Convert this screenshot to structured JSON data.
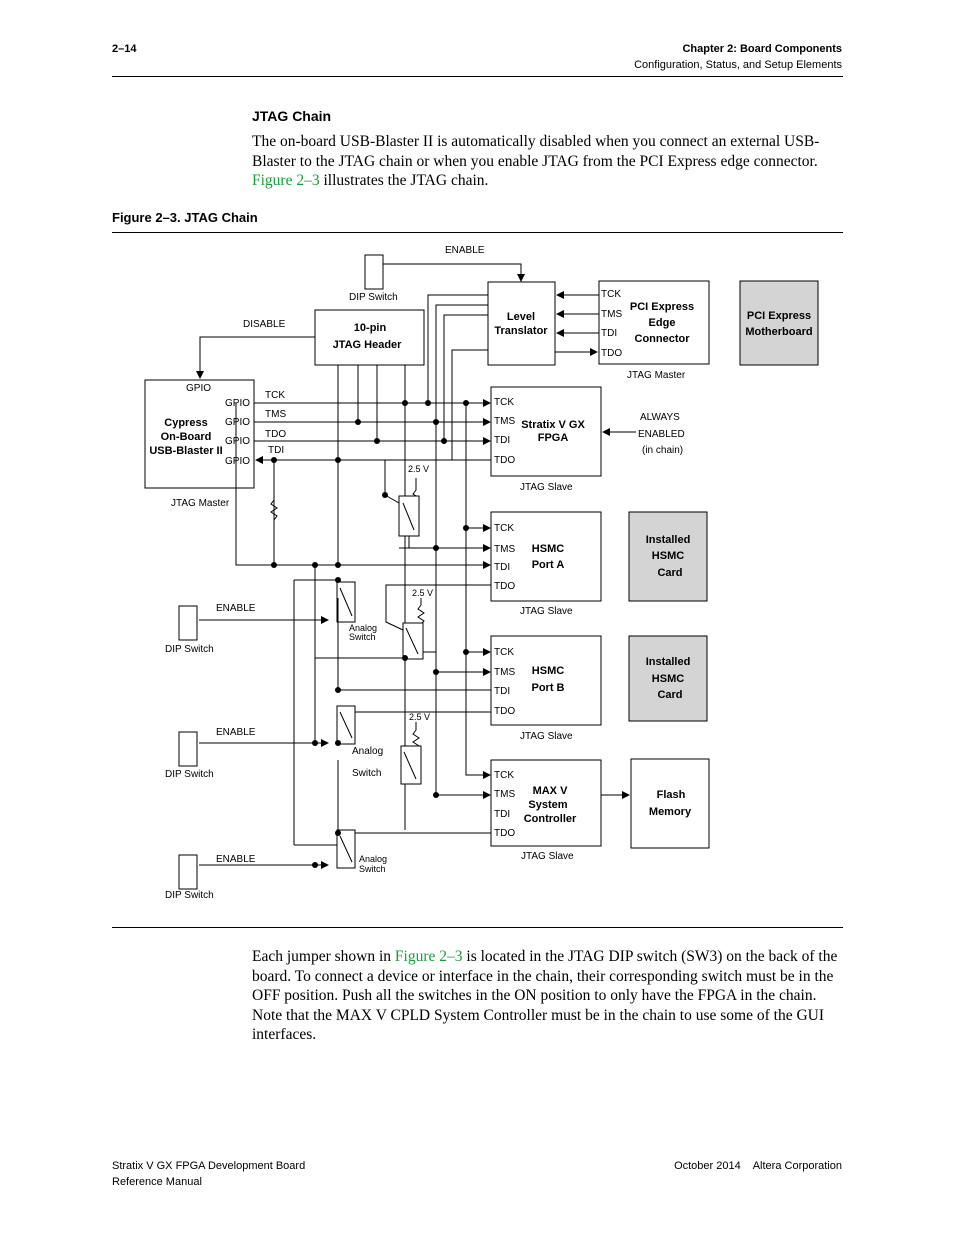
{
  "header": {
    "page_number": "2–14",
    "chapter": "Chapter 2:  Board Components",
    "section": "Configuration, Status, and Setup Elements"
  },
  "section": {
    "title": "JTAG Chain",
    "intro": {
      "part1": "The on-board USB-Blaster II is automatically disabled when you connect an external USB-Blaster to the JTAG chain or when you enable JTAG from the PCI Express edge connector. ",
      "link": "Figure 2–3",
      "part2": " illustrates the JTAG chain."
    }
  },
  "figure": {
    "caption": "Figure 2–3.  JTAG Chain",
    "colors": {
      "line": "#000000",
      "gray_box": "#d4d4d4",
      "box_border": "#000000"
    },
    "labels": {
      "enable": "ENABLE",
      "disable": "DISABLE",
      "dip_switch": "DIP Switch",
      "jtag_master": "JTAG Master",
      "jtag_slave": "JTAG Slave",
      "gpio": "GPIO",
      "v25": "2.5 V",
      "analog_switch_1": "Analog",
      "analog_switch_2": "Switch",
      "always_1": "ALWAYS",
      "always_2": "ENABLED",
      "always_3": "(in chain)",
      "tck": "TCK",
      "tms": "TMS",
      "tdi": "TDI",
      "tdo": "TDO"
    },
    "blocks": {
      "header_10pin": [
        "10-pin",
        "JTAG Header"
      ],
      "level_translator": [
        "Level",
        "Translator"
      ],
      "pcie_edge": [
        "PCI Express",
        "Edge",
        "Connector"
      ],
      "pcie_motherboard": [
        "PCI Express",
        "Motherboard"
      ],
      "cypress": [
        "Cypress",
        "On-Board",
        "USB-Blaster II"
      ],
      "stratix": [
        "Stratix V GX",
        "FPGA"
      ],
      "hsmc_a": [
        "HSMC",
        "Port A"
      ],
      "hsmc_b": [
        "HSMC",
        "Port B"
      ],
      "maxv": [
        "MAX V",
        "System",
        "Controller"
      ],
      "installed_hsmc": [
        "Installed",
        "HSMC",
        "Card"
      ],
      "flash": [
        "Flash",
        "Memory"
      ]
    }
  },
  "body": {
    "part1": "Each jumper shown in ",
    "link": "Figure 2–3",
    "part2": " is located in the JTAG DIP switch (SW3) on the back of the board. To connect a device or interface in the chain, their corresponding switch must be in the OFF position. Push all the switches in the ON position to only have the FPGA in the chain. Note that the MAX V CPLD System Controller must be in the chain to use some of the GUI interfaces."
  },
  "footer": {
    "doc_title": "Stratix V GX FPGA Development Board",
    "doc_subtitle": "Reference Manual",
    "date": "October 2014",
    "company": "Altera Corporation"
  }
}
